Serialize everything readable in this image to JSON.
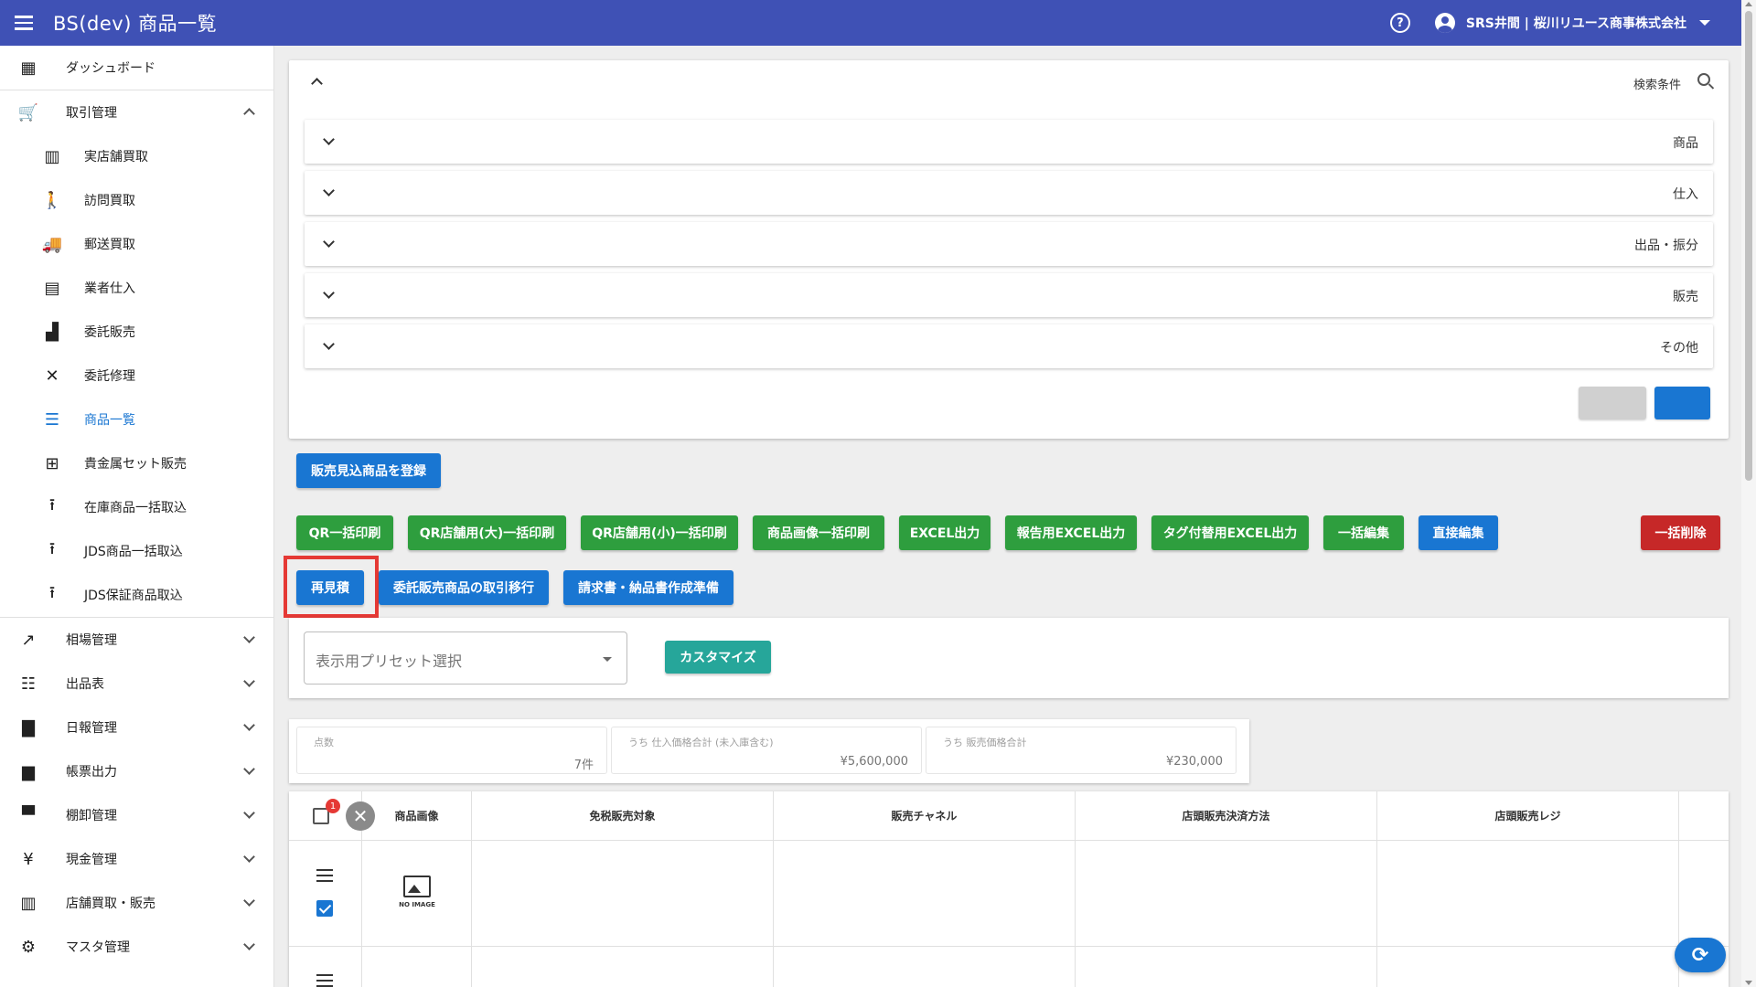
{
  "app": {
    "title": "BS(dev) 商品一覧",
    "user": "SRS井間 | 桜川リユース商事株式会社"
  },
  "sidebar": {
    "items": [
      {
        "label": "ダッシュボード",
        "icon": "dashboard-icon"
      },
      {
        "label": "取引管理",
        "icon": "cart-icon",
        "expanded": true
      },
      {
        "label": "実店舗買取",
        "icon": "store-icon"
      },
      {
        "label": "訪問買取",
        "icon": "walk-icon"
      },
      {
        "label": "郵送買取",
        "icon": "truck-icon"
      },
      {
        "label": "業者仕入",
        "icon": "building-icon"
      },
      {
        "label": "委託販売",
        "icon": "register-icon"
      },
      {
        "label": "委託修理",
        "icon": "tools-icon"
      },
      {
        "label": "商品一覧",
        "icon": "list-icon",
        "active": true
      },
      {
        "label": "貴金属セット販売",
        "icon": "grid-icon"
      },
      {
        "label": "在庫商品一括取込",
        "icon": "upload-icon"
      },
      {
        "label": "JDS商品一括取込",
        "icon": "upload-icon"
      },
      {
        "label": "JDS保証商品取込",
        "icon": "upload-icon"
      },
      {
        "label": "相場管理",
        "icon": "trending-icon"
      },
      {
        "label": "出品表",
        "icon": "checklist-icon"
      },
      {
        "label": "日報管理",
        "icon": "document-icon"
      },
      {
        "label": "帳票出力",
        "icon": "note-icon"
      },
      {
        "label": "棚卸管理",
        "icon": "archive-icon"
      },
      {
        "label": "現金管理",
        "icon": "yen-icon"
      },
      {
        "label": "店舗買取・販売",
        "icon": "shop-icon"
      },
      {
        "label": "マスタ管理",
        "icon": "gear-icon"
      }
    ]
  },
  "search": {
    "title": "検索条件",
    "sections": [
      "商品",
      "仕入",
      "出品・振分",
      "販売",
      "その他"
    ]
  },
  "actions": {
    "register": "販売見込商品を登録",
    "qr_bulk": "QR一括印刷",
    "qr_large": "QR店舗用(大)一括印刷",
    "qr_small": "QR店舗用(小)一括印刷",
    "image_bulk": "商品画像一括印刷",
    "excel": "EXCEL出力",
    "report_excel": "報告用EXCEL出力",
    "tag_excel": "タグ付替用EXCEL出力",
    "bulk_edit": "一括編集",
    "direct_edit": "直接編集",
    "bulk_delete": "一括削除",
    "reestimate": "再見積",
    "consign_transfer": "委託販売商品の取引移行",
    "invoice_prep": "請求書・納品書作成準備"
  },
  "preset": {
    "placeholder": "表示用プリセット選択",
    "customize": "カスタマイズ"
  },
  "summary": [
    {
      "label": "点数",
      "value": "7件"
    },
    {
      "label": "うち 仕入価格合計 (未入庫含む)",
      "value": "¥5,600,000"
    },
    {
      "label": "うち 販売価格合計",
      "value": "¥230,000"
    }
  ],
  "table": {
    "selected_count": "1",
    "headers": [
      "商品画像",
      "免税販売対象",
      "販売チャネル",
      "店頭販売決済方法",
      "店頭販売レジ"
    ],
    "no_image_label": "NO IMAGE"
  },
  "colors": {
    "appbar": "#3f51b5",
    "primary": "#1976d2",
    "success": "#2e9e3e",
    "danger": "#c62828",
    "teal": "#26a69a"
  }
}
